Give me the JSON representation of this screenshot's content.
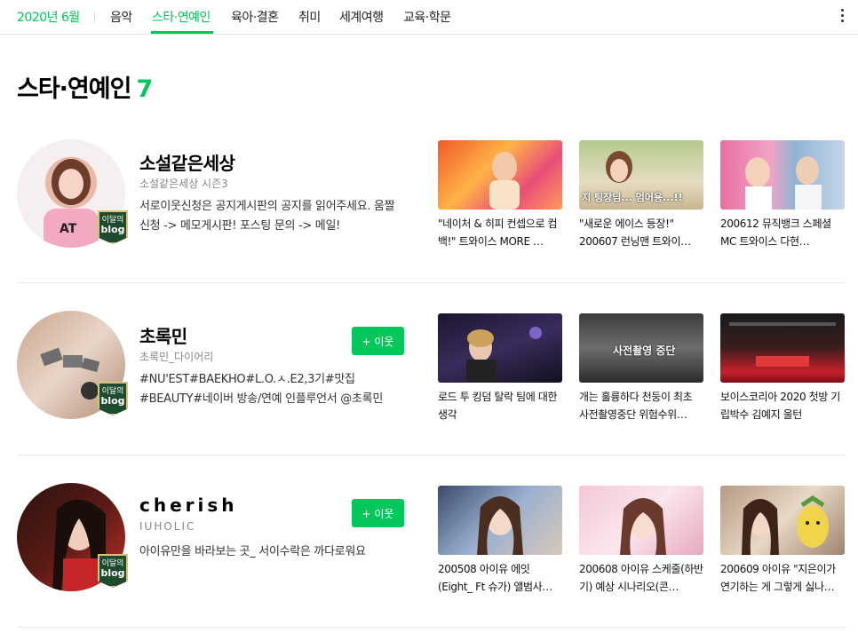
{
  "nav": {
    "month": "2020년 6월",
    "tabs": [
      "음악",
      "스타·연예인",
      "육아·결혼",
      "취미",
      "세계여행",
      "교육·학문"
    ],
    "active_index": 1
  },
  "page": {
    "title": "스타·연예인",
    "count": "7"
  },
  "badge": {
    "line1": "이달의",
    "line2": "blog"
  },
  "follow_label": "+ 이웃",
  "blogs": [
    {
      "name": "소설같은세상",
      "sub": "소설같은세상 시즌3",
      "desc": "서로이웃신청은 공지게시판의 공지를 읽어주세요. 움짤 신청 -> 메모게시판! 포스팅 문의 -> 메일!",
      "has_follow": false,
      "posts": [
        {
          "caption": "\"네이처 & 히피 컨셉으로 컴백!\" 트와이스 MORE …",
          "overlay": ""
        },
        {
          "caption": "\"새로운 에이스 등장!\" 200607 런닝맨 트와이…",
          "overlay": "지 팅장님...   멈어용...!!"
        },
        {
          "caption": "200612 뮤직뱅크 스페셜 MC 트와이스 다현…",
          "overlay": ""
        }
      ]
    },
    {
      "name": "초록민",
      "sub": "초록민_다이어리",
      "desc": "#NU'EST#BAEKHO#L.O.ㅅ.E2,3기#맛집 #BEAUTY#네이버 방송/연예 인플루언서 @초록민",
      "has_follow": true,
      "posts": [
        {
          "caption": "로드 투 킹덤 탈락 팀에 대한 생각",
          "overlay": ""
        },
        {
          "caption": "개는 훌륭하다 천둥이 최초 사전촬영중단 위험수위…",
          "overlay": "사전촬영 중단"
        },
        {
          "caption": "보이스코리아 2020 첫방 기립박수 김예지 울턴",
          "overlay": ""
        }
      ]
    },
    {
      "name": "cherish",
      "sub": "IUHOLIC",
      "desc": "아이유만을 바라보는 곳_ 서이수락은 까다로워요",
      "has_follow": true,
      "posts": [
        {
          "caption": "200508 아이유 에잇(Eight_ Ft 슈가) 앨범사…",
          "overlay": ""
        },
        {
          "caption": "200608 아이유 스케줄(하반기) 예상 시나리오(콘…",
          "overlay": ""
        },
        {
          "caption": "200609 아이유 \"지은이가 연기하는 게 그렇게 싫나…",
          "overlay": ""
        }
      ]
    }
  ]
}
